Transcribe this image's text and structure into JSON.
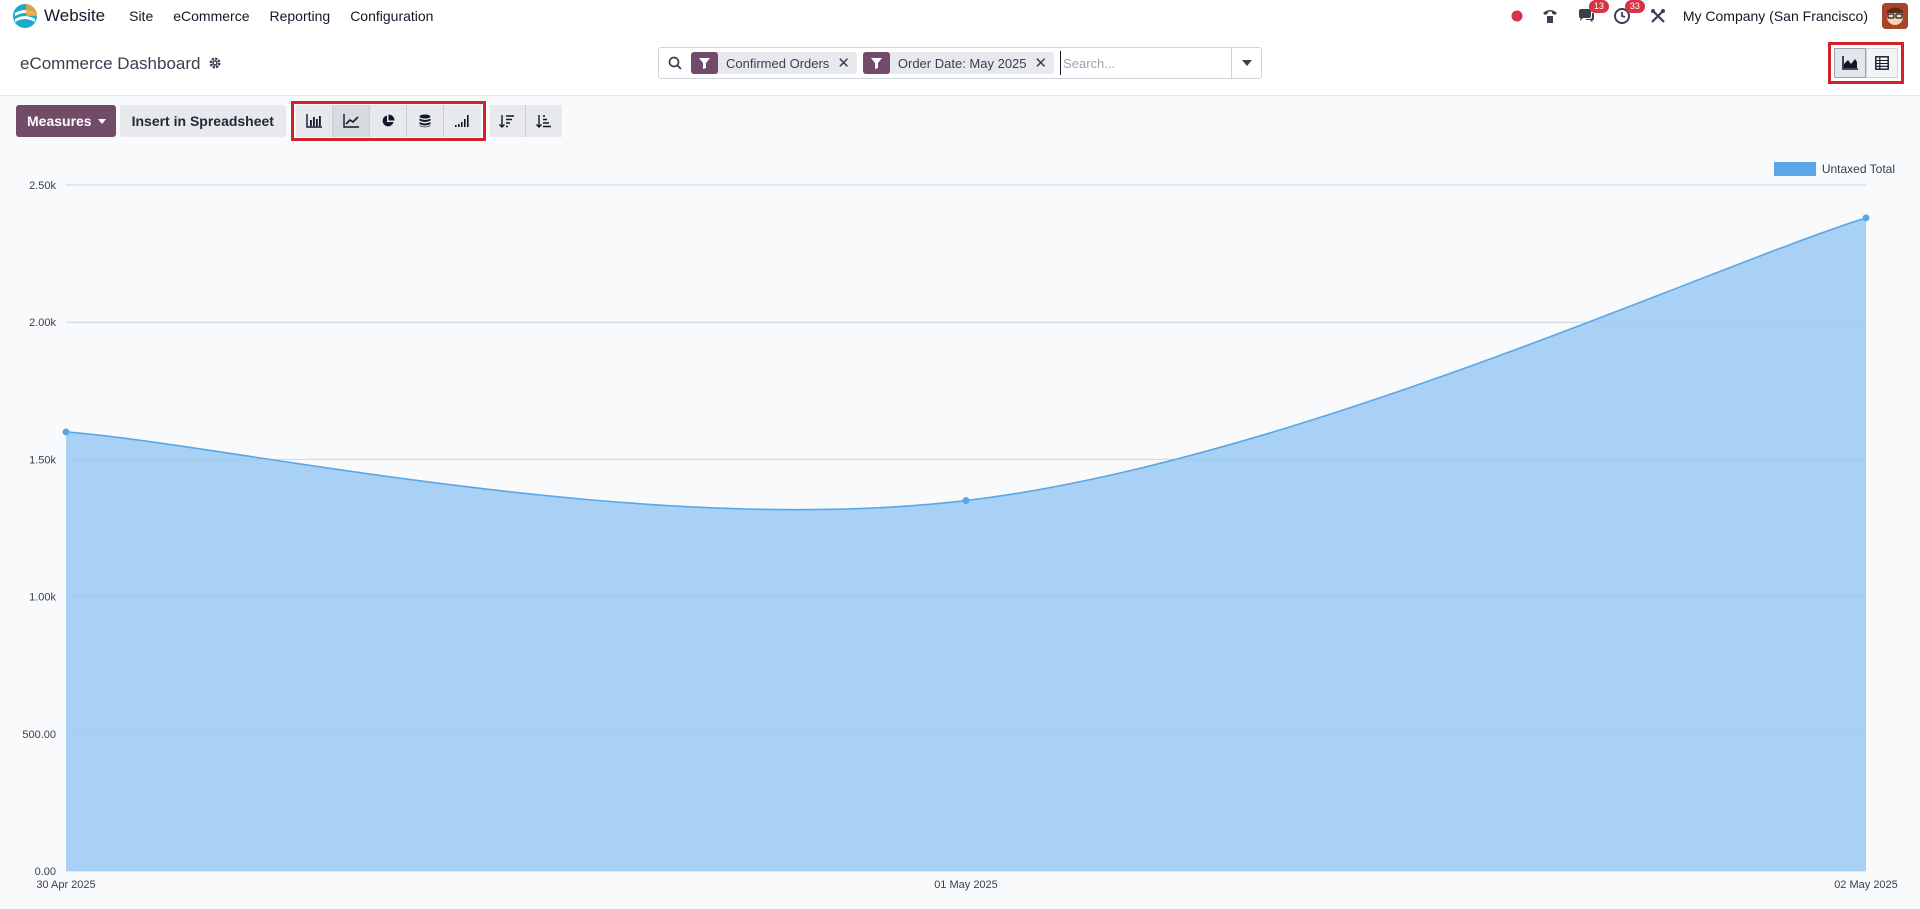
{
  "navbar": {
    "app_name": "Website",
    "menu": [
      "Site",
      "eCommerce",
      "Reporting",
      "Configuration"
    ],
    "messages_badge": "13",
    "activities_badge": "33",
    "company": "My Company (San Francisco)"
  },
  "control_panel": {
    "title": "eCommerce Dashboard",
    "facets": [
      "Confirmed Orders",
      "Order Date: May 2025"
    ],
    "search_placeholder": "Search..."
  },
  "toolbar": {
    "measures_label": "Measures",
    "insert_label": "Insert in Spreadsheet"
  },
  "colors": {
    "brand": "#714b67",
    "series_line": "#5aa7e8",
    "series_fill": "#a8d1f5",
    "highlight": "#d2232a"
  },
  "chart_data": {
    "type": "area",
    "x": [
      "30 Apr 2025",
      "01 May 2025",
      "02 May 2025"
    ],
    "series": [
      {
        "name": "Untaxed Total",
        "values": [
          1600,
          1350,
          2380
        ]
      }
    ],
    "yticks": [
      "0.00",
      "500.00",
      "1.00k",
      "1.50k",
      "2.00k",
      "2.50k"
    ],
    "ylim": [
      0,
      2500
    ],
    "legend": "top-right",
    "grid": true
  }
}
